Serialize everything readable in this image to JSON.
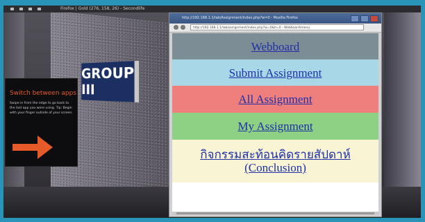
{
  "os": {
    "taskbar_title": "Firefox | Gold (276, 158, 26) - Secondlife"
  },
  "scene": {
    "sign_text": "GROUP III"
  },
  "tip": {
    "title": "Switch between apps",
    "body": "Swipe in from the edge to go back to the last app you were using. Tip: Begin with your finger outside of your screen."
  },
  "browser": {
    "title": "http://192.168.1.1/lab/Assignment/index.php?w=0 - Mozilla Firefox",
    "url": "http://192.168.1.1/lab/assignment/index.php?w=0&h=0 - Webboard/menu"
  },
  "menu": {
    "items": [
      {
        "label": "Webboard",
        "bg": "#7d8d96"
      },
      {
        "label": "Submit Assignment",
        "bg": "#a8d8e8"
      },
      {
        "label": "All Assignment",
        "bg": "#ef7f7c"
      },
      {
        "label": "My Assignment",
        "bg": "#8ed084"
      },
      {
        "label_line1": "กิจกรรมสะท้อนคิดรายสัปดาห์",
        "label_line2": "(Conclusion)",
        "bg": "#f8f4d4"
      }
    ]
  }
}
